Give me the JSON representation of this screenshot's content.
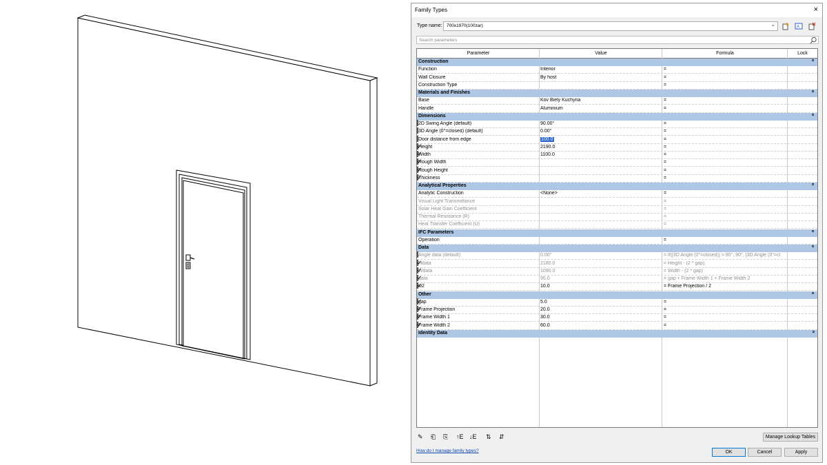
{
  "dialog": {
    "title": "Family Types",
    "close_glyph": "×",
    "type_name_label": "Type name:",
    "type_name_value": "700x1970(100zar)",
    "search_placeholder": "Search parameters",
    "toolbar_icons": [
      "new-type-icon",
      "rename-type-icon",
      "delete-type-icon"
    ],
    "columns": {
      "parameter": "Parameter",
      "value": "Value",
      "formula": "Formula",
      "lock": "Lock"
    },
    "groups": [
      {
        "name": "Construction",
        "rows": [
          {
            "parameter": "Function",
            "value": "Interior",
            "formula": "="
          },
          {
            "parameter": "Wall Closure",
            "value": "By host",
            "formula": "="
          },
          {
            "parameter": "Construction Type",
            "value": "",
            "formula": "="
          }
        ]
      },
      {
        "name": "Materials and Finishes",
        "rows": [
          {
            "parameter": "Base",
            "value": "Kov Biely Kuchyna",
            "formula": "="
          },
          {
            "parameter": "Handle",
            "value": "Aluminium",
            "formula": "="
          }
        ]
      },
      {
        "name": "Dimensions",
        "rows": [
          {
            "parameter": "2D Swing Angle (default)",
            "value": "90.00°",
            "formula": "=",
            "lock": false
          },
          {
            "parameter": "3D Angle (0°=closed) (default)",
            "value": "0.00°",
            "formula": "=",
            "lock": false
          },
          {
            "parameter": "Door distance from edge",
            "value": "100.0",
            "formula": "=",
            "lock": false,
            "selected": true
          },
          {
            "parameter": "Height",
            "value": "2190.0",
            "formula": "=",
            "lock": true
          },
          {
            "parameter": "Width",
            "value": "1100.0",
            "formula": "=",
            "lock": true
          },
          {
            "parameter": "Rough Width",
            "value": "",
            "formula": "=",
            "lock": true
          },
          {
            "parameter": "Rough Height",
            "value": "",
            "formula": "=",
            "lock": true
          },
          {
            "parameter": "Thickness",
            "value": "",
            "formula": "=",
            "lock": true
          }
        ]
      },
      {
        "name": "Analytical Properties",
        "rows": [
          {
            "parameter": "Analytic Construction",
            "value": "<None>",
            "formula": "="
          },
          {
            "parameter": "Visual Light Transmittance",
            "value": "",
            "formula": "=",
            "dim": true
          },
          {
            "parameter": "Solar Heat Gain Coefficient",
            "value": "",
            "formula": "=",
            "dim": true
          },
          {
            "parameter": "Thermal Resistance (R)",
            "value": "",
            "formula": "=",
            "dim": true
          },
          {
            "parameter": "Heat Transfer Coefficient (U)",
            "value": "",
            "formula": "=",
            "dim": true
          }
        ]
      },
      {
        "name": "IFC Parameters",
        "rows": [
          {
            "parameter": "Operation",
            "value": "",
            "formula": "="
          }
        ]
      },
      {
        "name": "Data",
        "rows": [
          {
            "parameter": "Angle data (default)",
            "value": "0.00°",
            "formula": "= if([3D Angle (0°=closed)] > 90°, 90°, [3D Angle (0°=cl",
            "lock": false,
            "dim": true
          },
          {
            "parameter": "Hdata",
            "value": "2180.0",
            "formula": "= Height - (2 * gap)",
            "lock": true,
            "dim": true
          },
          {
            "parameter": "Wdata",
            "value": "1090.0",
            "formula": "= Width - (2 * gap)",
            "lock": true,
            "dim": true
          },
          {
            "parameter": "data",
            "value": "95.0",
            "formula": "= gap + Frame Width 1 + Frame Width 2",
            "lock": true,
            "dim": true
          },
          {
            "parameter": "w2",
            "value": "10.0",
            "formula": "= Frame Projection / 2",
            "lock": true
          }
        ]
      },
      {
        "name": "Other",
        "rows": [
          {
            "parameter": "gap",
            "value": "5.0",
            "formula": "=",
            "lock": true
          },
          {
            "parameter": "Frame Projection",
            "value": "20.0",
            "formula": "=",
            "lock": true
          },
          {
            "parameter": "Frame Width 1",
            "value": "30.0",
            "formula": "=",
            "lock": true
          },
          {
            "parameter": "Frame Width 2",
            "value": "60.0",
            "formula": "=",
            "lock": true
          }
        ]
      },
      {
        "name": "Identity Data",
        "collapsed": true,
        "rows": []
      }
    ],
    "collapse_glyph": "»",
    "bottom_toolbar_icons": [
      {
        "name": "edit-parameter-icon",
        "glyph": "✎"
      },
      {
        "name": "new-parameter-icon",
        "glyph": "⎗"
      },
      {
        "name": "delete-parameter-icon",
        "glyph": "⎘"
      },
      {
        "name": "move-up-icon",
        "glyph": "↑E"
      },
      {
        "name": "move-down-icon",
        "glyph": "↓E"
      },
      {
        "name": "sort-ascending-icon",
        "glyph": "⇅"
      },
      {
        "name": "sort-descending-icon",
        "glyph": "⇵"
      }
    ],
    "manage_lookup_label": "Manage Lookup Tables",
    "help_link": "How do I manage family types?",
    "ok_label": "OK",
    "cancel_label": "Cancel",
    "apply_label": "Apply"
  }
}
